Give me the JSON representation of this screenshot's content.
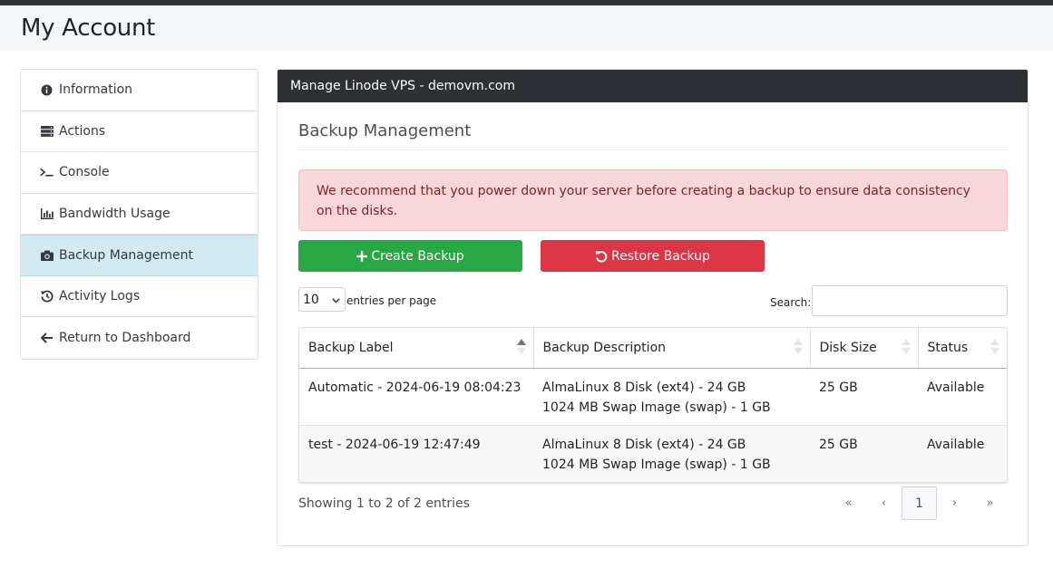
{
  "page": {
    "title": "My Account"
  },
  "sidebar": {
    "items": [
      {
        "label": "Information",
        "icon": "info-circle-icon"
      },
      {
        "label": "Actions",
        "icon": "server-icon"
      },
      {
        "label": "Console",
        "icon": "terminal-icon"
      },
      {
        "label": "Bandwidth Usage",
        "icon": "bar-chart-icon"
      },
      {
        "label": "Backup Management",
        "icon": "camera-icon",
        "active": true
      },
      {
        "label": "Activity Logs",
        "icon": "history-icon"
      },
      {
        "label": "Return to Dashboard",
        "icon": "arrow-left-icon"
      }
    ]
  },
  "panel": {
    "header": "Manage Linode VPS - demovm.com",
    "section_title": "Backup Management",
    "alert": "We recommend that you power down your server before creating a backup to ensure data consistency on the disks.",
    "create_button": "Create Backup",
    "restore_button": "Restore Backup",
    "length_value": "10",
    "length_label": "entries per page",
    "search_label": "Search:",
    "search_value": "",
    "columns": [
      "Backup Label",
      "Backup Description",
      "Disk Size",
      "Status"
    ],
    "rows": [
      {
        "label": "Automatic - 2024-06-19 08:04:23",
        "desc_line1": "AlmaLinux 8 Disk (ext4) - 24 GB",
        "desc_line2": "1024 MB Swap Image (swap) - 1 GB",
        "size": "25 GB",
        "status": "Available"
      },
      {
        "label": "test - 2024-06-19 12:47:49",
        "desc_line1": "AlmaLinux 8 Disk (ext4) - 24 GB",
        "desc_line2": "1024 MB Swap Image (swap) - 1 GB",
        "size": "25 GB",
        "status": "Available"
      }
    ],
    "showing": "Showing 1 to 2 of 2 entries",
    "pager": {
      "first": "«",
      "prev": "‹",
      "current": "1",
      "next": "›",
      "last": "»"
    }
  },
  "colors": {
    "dark_header": "#2d3035",
    "active_item": "#d1ebf1",
    "alert_bg": "#f8d7da",
    "alert_text": "#842029",
    "success": "#28a745",
    "danger": "#dc3545"
  }
}
